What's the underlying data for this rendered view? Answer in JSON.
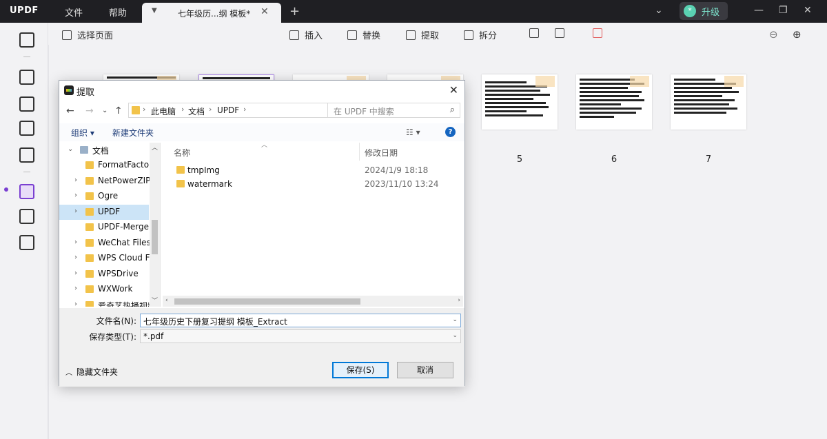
{
  "app": {
    "logo": "UPDF",
    "menu": [
      "文件",
      "帮助"
    ],
    "tab_title": "七年级历...纲 模板*",
    "upgrade_label": "升级",
    "accent_color": "#7a3fd1"
  },
  "toolbar": {
    "select_pages": "选择页面",
    "insert": "插入",
    "replace": "替换",
    "extract": "提取",
    "split": "拆分"
  },
  "pages": {
    "numbers": [
      "5",
      "6",
      "7"
    ]
  },
  "dialog": {
    "title": "提取",
    "breadcrumb": [
      "此电脑",
      "文档",
      "UPDF"
    ],
    "search_placeholder": "在 UPDF 中搜索",
    "organize": "组织 ▾",
    "new_folder": "新建文件夹",
    "tree": [
      {
        "label": "文档",
        "expanded": true
      },
      {
        "label": "FormatFactory"
      },
      {
        "label": "NetPowerZIPD"
      },
      {
        "label": "Ogre"
      },
      {
        "label": "UPDF",
        "selected": true
      },
      {
        "label": "UPDF-Merge"
      },
      {
        "label": "WeChat Files"
      },
      {
        "label": "WPS Cloud Fil"
      },
      {
        "label": "WPSDrive"
      },
      {
        "label": "WXWork"
      },
      {
        "label": "爱奇艺热播视频"
      }
    ],
    "columns": {
      "name": "名称",
      "modified": "修改日期"
    },
    "files": [
      {
        "name": "tmpImg",
        "modified": "2024/1/9 18:18"
      },
      {
        "name": "watermark",
        "modified": "2023/11/10 13:24"
      }
    ],
    "filename_label": "文件名(N):",
    "filename_value": "七年级历史下册复习提纲 模板_Extract",
    "filetype_label": "保存类型(T):",
    "filetype_value": "*.pdf",
    "hide_folders": "隐藏文件夹",
    "save": "保存(S)",
    "cancel": "取消"
  }
}
